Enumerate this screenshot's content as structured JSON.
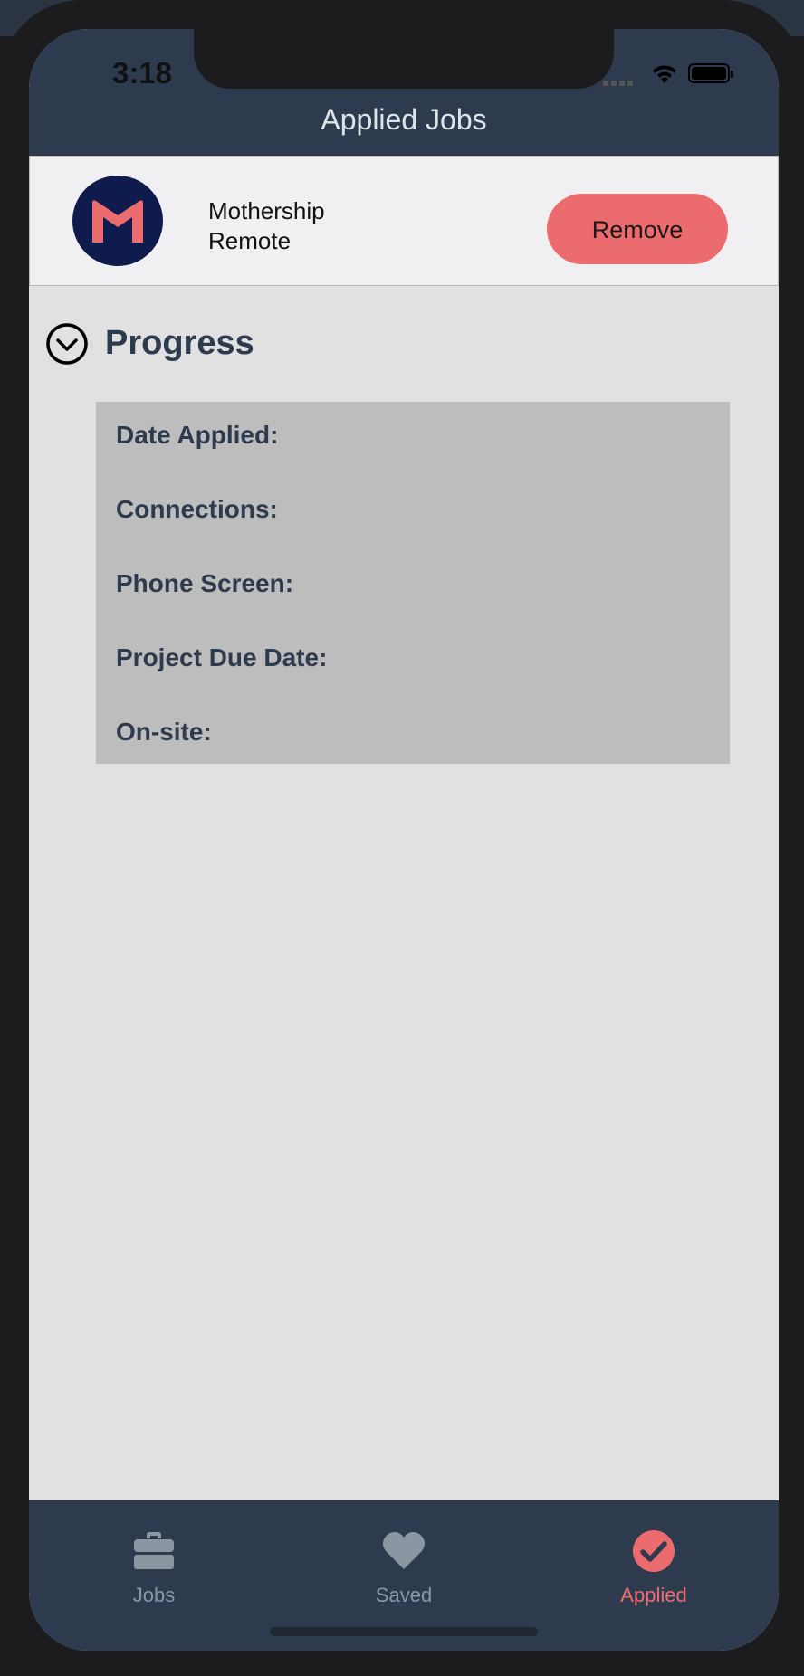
{
  "status_bar": {
    "time": "3:18"
  },
  "nav": {
    "title": "Applied Jobs"
  },
  "job": {
    "company_line1": "Mothership",
    "company_line2": "Remote",
    "remove_label": "Remove"
  },
  "progress": {
    "title": "Progress",
    "fields": [
      {
        "label": "Date Applied:"
      },
      {
        "label": "Connections:"
      },
      {
        "label": "Phone Screen:"
      },
      {
        "label": "Project Due Date:"
      },
      {
        "label": "On-site:"
      }
    ]
  },
  "tabs": [
    {
      "label": "Jobs",
      "icon": "briefcase-icon"
    },
    {
      "label": "Saved",
      "icon": "heart-icon"
    },
    {
      "label": "Applied",
      "icon": "check-circle-icon"
    }
  ],
  "active_tab": "Applied",
  "colors": {
    "nav_background": "#2e3b4e",
    "accent": "#ec6b6e",
    "logo_background": "#0f1b4c",
    "content_background": "#e1e1e1",
    "card_background": "#f0f0f2",
    "detail_panel": "#bdbdbd",
    "inactive_tab": "#8c96a3"
  }
}
